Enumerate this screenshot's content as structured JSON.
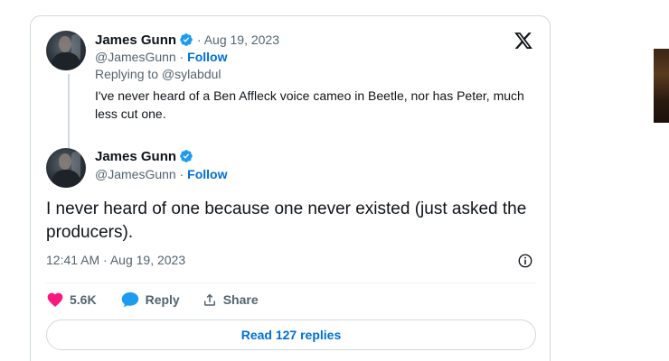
{
  "parent_tweet": {
    "author_name": "James Gunn",
    "date_separator": " · ",
    "date": "Aug 19, 2023",
    "handle": "@JamesGunn",
    "handle_separator": " · ",
    "follow_label": "Follow",
    "replying_to": "Replying to @sylabdul",
    "text": "I've never heard of a Ben Affleck voice cameo in Beetle, nor has Peter, much less cut one."
  },
  "main_tweet": {
    "author_name": "James Gunn",
    "handle": "@JamesGunn",
    "handle_separator": " · ",
    "follow_label": "Follow",
    "text": "I never heard of one because one never existed (just asked the producers).",
    "timestamp": "12:41 AM · Aug 19, 2023"
  },
  "actions": {
    "likes_count": "5.6K",
    "reply_label": "Reply",
    "share_label": "Share"
  },
  "read_replies_label": "Read 127 replies",
  "icons": {
    "brand": "x-logo-icon",
    "verified": "verified-badge-icon",
    "like": "heart-icon",
    "reply": "speech-bubble-icon",
    "share": "share-upload-icon",
    "info": "info-icon"
  },
  "colors": {
    "like": "#f91880",
    "verified": "#1d9bf0",
    "link": "#006fd6",
    "muted": "#536471",
    "text": "#0f1419",
    "border": "#cfd9de"
  }
}
